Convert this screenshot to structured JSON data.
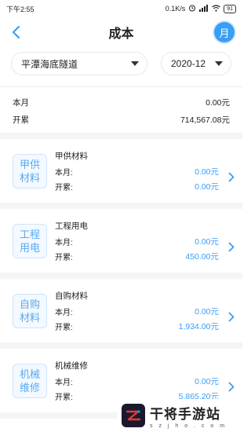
{
  "status_bar": {
    "time": "下午2:55",
    "speed": "0.1K/s",
    "battery": "91"
  },
  "header": {
    "title": "成本",
    "month_button": "月"
  },
  "filters": {
    "project": "平潭海底隧道",
    "date": "2020-12"
  },
  "summary": {
    "month_label": "本月",
    "month_value": "0.00元",
    "cumulative_label": "开累",
    "cumulative_value": "714,567.08元"
  },
  "cards": [
    {
      "badge": "甲供材料",
      "name": "甲供材料",
      "month_label": "本月:",
      "month_value": "0.00元",
      "cumulative_label": "开累:",
      "cumulative_value": "0.00元"
    },
    {
      "badge": "工程用电",
      "name": "工程用电",
      "month_label": "本月:",
      "month_value": "0.00元",
      "cumulative_label": "开累:",
      "cumulative_value": "450.00元"
    },
    {
      "badge": "自购材料",
      "name": "自购材料",
      "month_label": "本月:",
      "month_value": "0.00元",
      "cumulative_label": "开累:",
      "cumulative_value": "1,934.00元"
    },
    {
      "badge": "机械维修",
      "name": "机械维修",
      "month_label": "本月:",
      "month_value": "0.00元",
      "cumulative_label": "开累:",
      "cumulative_value": "5,865.20元"
    }
  ],
  "watermark": {
    "title": "干将手游站",
    "subtitle": "s z j h o . c o m"
  },
  "colors": {
    "accent": "#3a9ef5",
    "badge_text": "#5aa9f0",
    "badge_bg": "#f3f9ff"
  }
}
